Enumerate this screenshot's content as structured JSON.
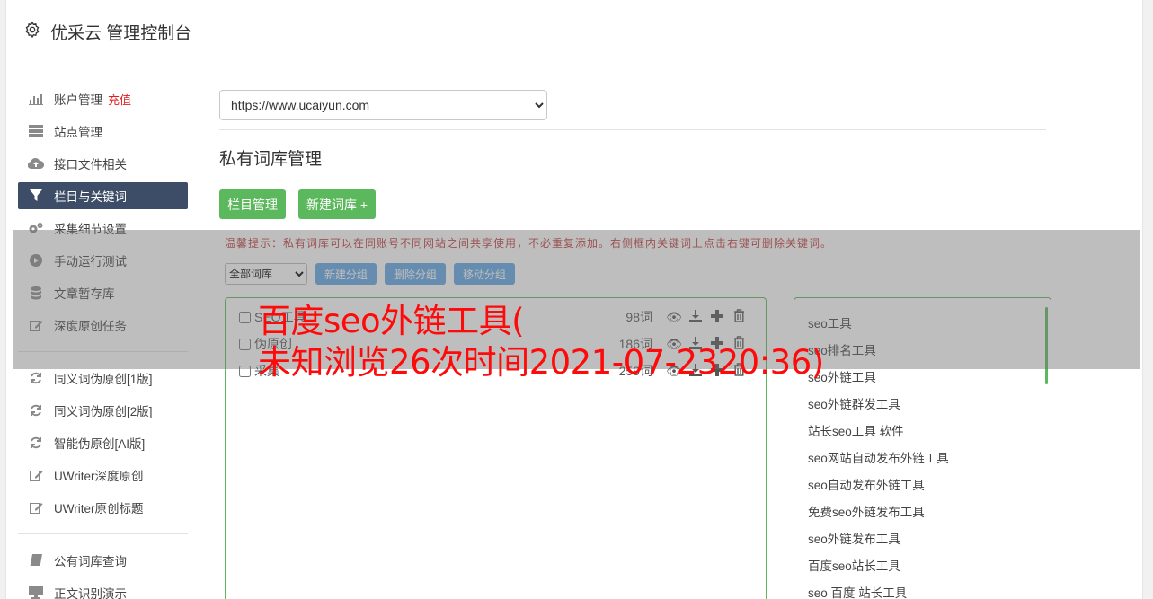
{
  "header": {
    "title": "优采云 管理控制台",
    "icon": "gear-icon"
  },
  "sidebar": {
    "group1": [
      {
        "label": "账户管理",
        "badge": "充值",
        "icon": "bar-chart-icon"
      },
      {
        "label": "站点管理",
        "icon": "server-icon"
      },
      {
        "label": "接口文件相关",
        "icon": "cloud-upload-icon"
      },
      {
        "label": "栏目与关键词",
        "icon": "filter-icon",
        "active": true
      },
      {
        "label": "采集细节设置",
        "icon": "cogs-icon"
      },
      {
        "label": "手动运行测试",
        "icon": "play-circle-icon"
      },
      {
        "label": "文章暂存库",
        "icon": "database-icon"
      },
      {
        "label": "深度原创任务",
        "icon": "edit-icon"
      }
    ],
    "group2": [
      {
        "label": "同义词伪原创[1版]",
        "icon": "refresh-icon"
      },
      {
        "label": "同义词伪原创[2版]",
        "icon": "refresh-icon"
      },
      {
        "label": "智能伪原创[AI版]",
        "icon": "refresh-icon"
      },
      {
        "label": "UWriter深度原创",
        "icon": "edit-icon"
      },
      {
        "label": "UWriter原创标题",
        "icon": "edit-icon"
      }
    ],
    "group3": [
      {
        "label": "公有词库查询",
        "icon": "book-icon"
      },
      {
        "label": "正文识别演示",
        "icon": "monitor-icon"
      }
    ]
  },
  "main": {
    "site_select": "https://www.ucaiyun.com",
    "section_title": "私有词库管理",
    "buttons": {
      "column_manage": "栏目管理",
      "new_lib": "新建词库 +"
    },
    "tip": "温馨提示：私有词库可以在同账号不同网站之间共享使用，不必重复添加。右侧框内关键词上点击右键可删除关键词。",
    "tools": {
      "filter": "全部词库",
      "new_group": "新建分组",
      "delete_group": "删除分组",
      "move_group": "移动分组"
    },
    "libraries": [
      {
        "name": "SEO工具",
        "count": "98词"
      },
      {
        "name": "伪原创",
        "count": "186词"
      },
      {
        "name": "采集",
        "count": "259词"
      }
    ],
    "keywords": [
      "seo工具",
      "seo排名工具",
      "seo外链工具",
      "seo外链群发工具",
      "站长seo工具 软件",
      "seo网站自动发布外链工具",
      "seo自动发布外链工具",
      "免费seo外链发布工具",
      "seo外链发布工具",
      "百度seo站长工具",
      "seo 百度 站长工具"
    ]
  },
  "watermark": {
    "line1": "百度seo外链工具(",
    "line2": "未知浏览26次时间2021-07-2320:36)"
  }
}
